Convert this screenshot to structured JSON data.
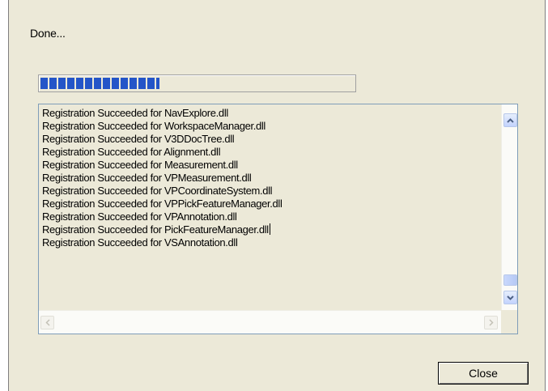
{
  "status_text": "Done...",
  "progress": {
    "fraction": 0.38
  },
  "log": {
    "lines": [
      "Registration Succeeded for NavExplore.dll",
      "Registration Succeeded for WorkspaceManager.dll",
      "Registration Succeeded for V3DDocTree.dll",
      "Registration Succeeded for Alignment.dll",
      "Registration Succeeded for Measurement.dll",
      "Registration Succeeded for VPMeasurement.dll",
      "Registration Succeeded for VPCoordinateSystem.dll",
      "Registration Succeeded for VPPickFeatureManager.dll",
      "Registration Succeeded for VPAnnotation.dll",
      "Registration Succeeded for PickFeatureManager.dll",
      "Registration Succeeded for VSAnnotation.dll"
    ],
    "caret_line": 9
  },
  "buttons": {
    "close_label": "Close"
  },
  "icons": {
    "scroll_up": "arrow-up-icon",
    "scroll_down": "arrow-down-icon",
    "scroll_left": "arrow-left-icon",
    "scroll_right": "arrow-right-icon"
  },
  "colors": {
    "dialog_bg": "#ece9d8",
    "progress_fill": "#2455c8",
    "scroll_button": "#c3d3fd"
  }
}
